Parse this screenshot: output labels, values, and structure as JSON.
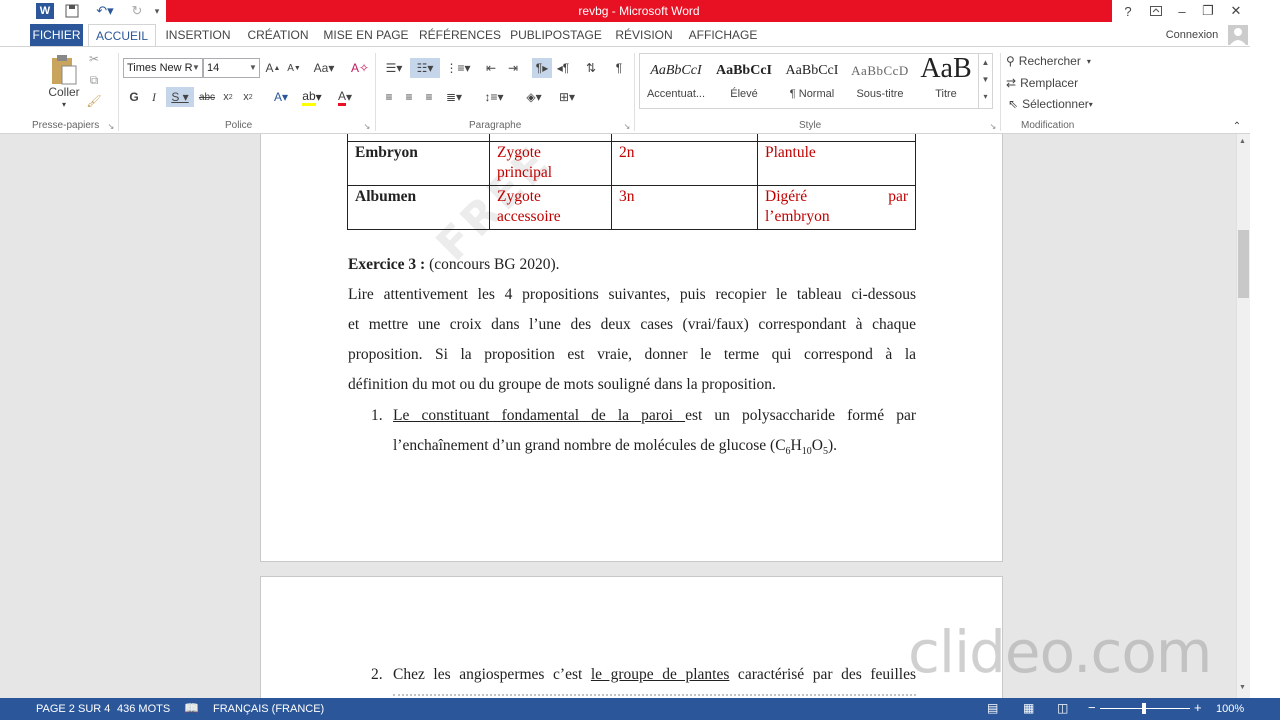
{
  "window": {
    "title": "revbg -  Microsoft Word",
    "help": "?",
    "minimize": "–",
    "restore": "❐",
    "close": "✕"
  },
  "tabs": {
    "file": "FICHIER",
    "items": [
      "ACCUEIL",
      "INSERTION",
      "CRÉATION",
      "MISE EN PAGE",
      "RÉFÉRENCES",
      "PUBLIPOSTAGE",
      "RÉVISION",
      "AFFICHAGE"
    ],
    "account": "Connexion"
  },
  "ribbon": {
    "clipboard": {
      "paste": "Coller",
      "label": "Presse-papiers"
    },
    "font": {
      "name": "Times New R",
      "size": "14",
      "label": "Police"
    },
    "paragraph": {
      "label": "Paragraphe"
    },
    "styles": {
      "label": "Style",
      "items": [
        {
          "preview": "AaBbCcI",
          "name": "Accentuat..."
        },
        {
          "preview": "AaBbCcI",
          "name": "Élevé"
        },
        {
          "preview": "AaBbCcI",
          "name": "¶ Normal"
        },
        {
          "preview": "AaBbCcD",
          "name": "Sous-titre"
        },
        {
          "preview": "AaB",
          "name": "Titre"
        }
      ]
    },
    "editing": {
      "find": "Rechercher",
      "replace": "Remplacer",
      "select": "Sélectionner",
      "label": "Modification"
    }
  },
  "document": {
    "table_rows": [
      {
        "c1": "Embryon",
        "c2a": "Zygote",
        "c2b": "principal",
        "c3": "2n",
        "c4a": "Plantule",
        "c4b": ""
      },
      {
        "c1": "Albumen",
        "c2a": "Zygote",
        "c2b": "accessoire",
        "c3": "3n",
        "c4a": "Digéré",
        "c4pa": "par",
        "c4b": "l’embryon"
      }
    ],
    "ex_title": "Exercice 3 :",
    "ex_source": " (concours BG 2020).",
    "intro": [
      "Lire attentivement les 4 propositions suivantes, puis recopier le tableau ci-dessous",
      "et mettre une croix dans l’une des deux cases (vrai/faux) correspondant à chaque",
      "proposition. Si la proposition est vraie, donner le terme qui correspond à la",
      "définition du mot ou du groupe de mots souligné dans la proposition."
    ],
    "item1": {
      "num": "1.",
      "underlined": "Le constituant fondamental de la paroi ",
      "rest": "est un polysaccharide formé par",
      "line2": "l’enchaînement d’un grand nombre de molécules de glucose (C",
      "sub1": "6",
      "h": "H",
      "sub2": "10",
      "o": "O",
      "sub3": "5",
      "end": ")."
    },
    "item2": {
      "num": "2.",
      "pre": "Chez les angiospermes c’est ",
      "underlined": "le groupe de plantes",
      "post": " caractérisé par des feuilles"
    }
  },
  "status": {
    "page": "PAGE 2 SUR 4",
    "words": "436 MOTS",
    "language": "FRANÇAIS (FRANCE)",
    "zoom": "100%"
  },
  "watermark": "clideo.com"
}
